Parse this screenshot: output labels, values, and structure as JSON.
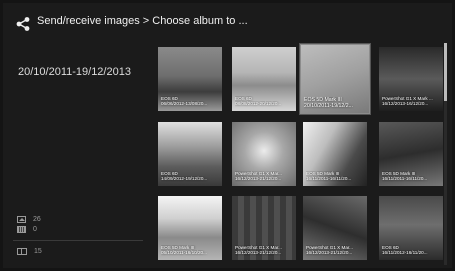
{
  "header": {
    "title": "Send/receive images > Choose album to ...",
    "share_icon": "share-icon"
  },
  "sidebar": {
    "date_range": "20/10/2011-19/12/2013",
    "image_count": "26",
    "video_count": "0",
    "album_count": "15"
  },
  "colors": {
    "background": "#1b1b1b",
    "text": "#e8e8e8",
    "accent_scroll": "#bcbcbc"
  },
  "albums": [
    {
      "model": "EOS 6D",
      "dates": "06/06/2012-13/08/20...",
      "selected": false
    },
    {
      "model": "EOS 6D",
      "dates": "08/08/2012-20/12/20...",
      "selected": false
    },
    {
      "model": "EOS 5D Mark III",
      "dates": "20/10/2011-19/12/2...",
      "selected": true
    },
    {
      "model": "PowerShot G1 X Mark ...",
      "dates": "16/12/2013-16/12/20...",
      "selected": false
    },
    {
      "model": "EOS 6D",
      "dates": "14/09/2012-19/12/20...",
      "selected": false
    },
    {
      "model": "PowerShot G1 X Mar...",
      "dates": "16/12/2013-21/12/20...",
      "selected": false
    },
    {
      "model": "EOS 5D Mark III",
      "dates": "16/11/2011-16/11/20...",
      "selected": false
    },
    {
      "model": "EOS 5D Mark III",
      "dates": "16/11/2011-16/11/20...",
      "selected": false
    },
    {
      "model": "EOS 5D Mark III",
      "dates": "05/10/2011-16/10/20...",
      "selected": false
    },
    {
      "model": "PowerShot G1 X Mar...",
      "dates": "16/12/2013-21/12/20...",
      "selected": false
    },
    {
      "model": "PowerShot G1 X Mar...",
      "dates": "16/12/2013-21/12/20...",
      "selected": false
    },
    {
      "model": "EOS 6D",
      "dates": "16/11/2012-16/11/20...",
      "selected": false
    }
  ]
}
